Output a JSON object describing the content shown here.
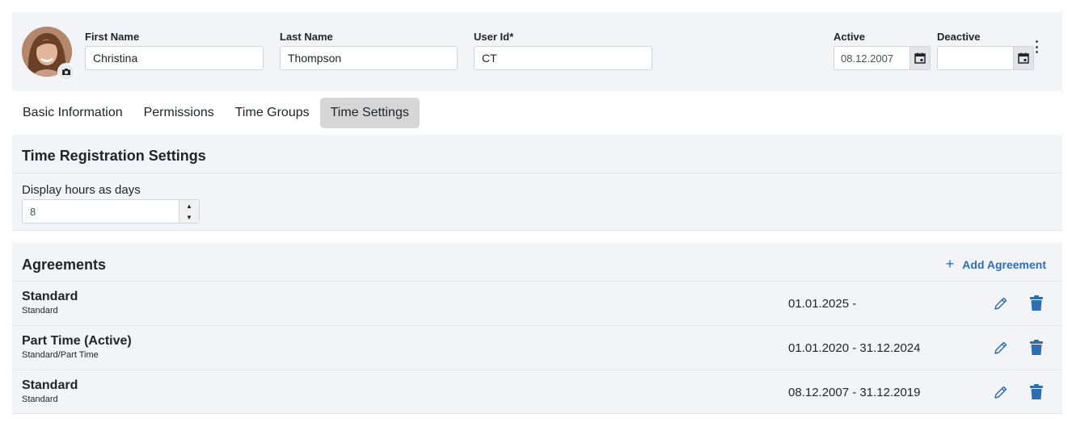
{
  "profile": {
    "first_name_label": "First Name",
    "first_name_value": "Christina",
    "last_name_label": "Last Name",
    "last_name_value": "Thompson",
    "user_id_label": "User Id*",
    "user_id_value": "CT",
    "active_label": "Active",
    "active_date": "08.12.2007",
    "deactive_label": "Deactive",
    "deactive_date": ""
  },
  "tabs": [
    {
      "label": "Basic Information",
      "active": false
    },
    {
      "label": "Permissions",
      "active": false
    },
    {
      "label": "Time Groups",
      "active": false
    },
    {
      "label": "Time Settings",
      "active": true
    }
  ],
  "time_settings": {
    "title": "Time Registration Settings",
    "display_hours_label": "Display hours as days",
    "display_hours_value": "8"
  },
  "agreements": {
    "title": "Agreements",
    "add_label": "Add Agreement",
    "items": [
      {
        "name": "Standard",
        "sub": "Standard",
        "period": "01.01.2025 -"
      },
      {
        "name": "Part Time (Active)",
        "sub": "Standard/Part Time",
        "period": "01.01.2020 - 31.12.2024"
      },
      {
        "name": "Standard",
        "sub": "Standard",
        "period": "08.12.2007 - 31.12.2019"
      }
    ]
  },
  "icons": {
    "camera": "camera-icon",
    "calendar": "calendar-icon",
    "more": "kebab-menu-icon",
    "edit": "pencil-icon",
    "delete": "trash-icon",
    "add": "plus-icon"
  },
  "colors": {
    "accent": "#2f6db3",
    "card_bg": "#f3f4f8",
    "active_tab_bg": "#d6d6d6"
  }
}
